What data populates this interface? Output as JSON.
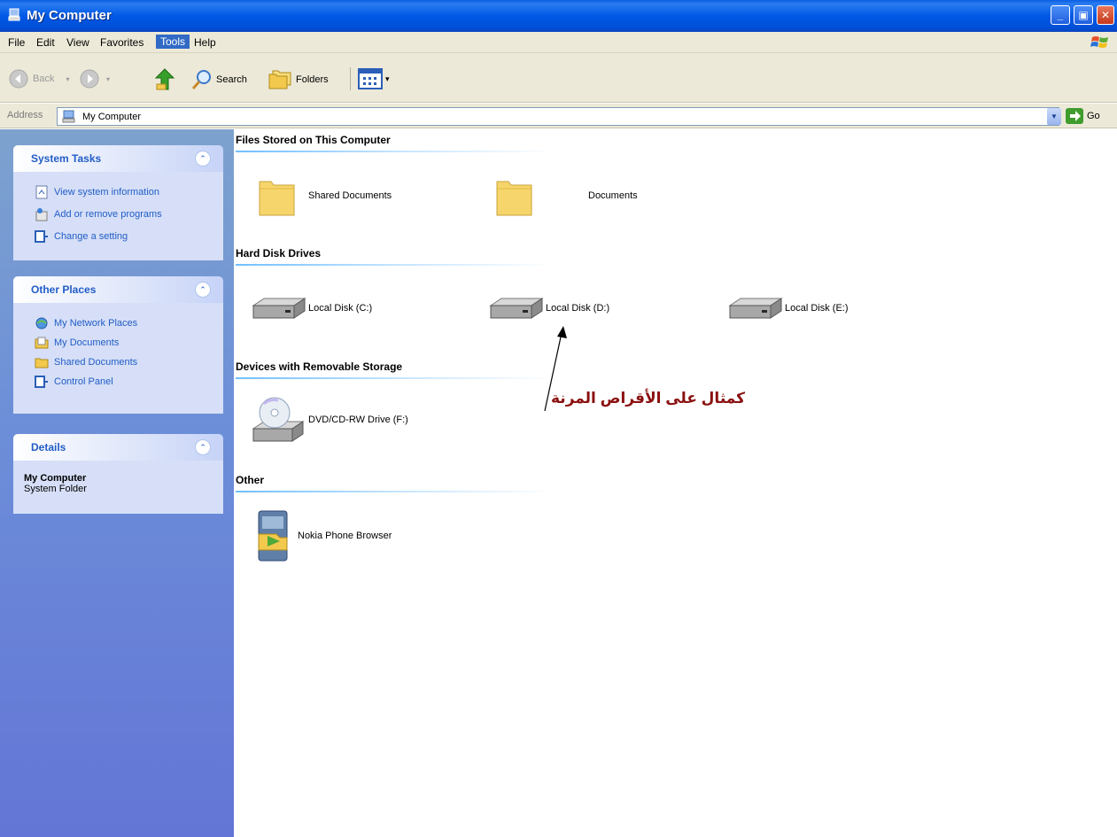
{
  "window": {
    "title": "My Computer"
  },
  "menu": [
    "File",
    "Edit",
    "View",
    "Favorites",
    "Tools",
    "Help"
  ],
  "toolbar": {
    "back": "Back",
    "search": "Search",
    "folders": "Folders"
  },
  "address": {
    "label": "Address",
    "value": "My Computer",
    "go": "Go"
  },
  "sidebar": {
    "system_tasks": {
      "title": "System Tasks",
      "items": [
        "View system information",
        "Add or remove programs",
        "Change a setting"
      ]
    },
    "other_places": {
      "title": "Other Places",
      "items": [
        "My Network Places",
        "My Documents",
        "Shared Documents",
        "Control Panel"
      ]
    },
    "details": {
      "title": "Details",
      "name": "My Computer",
      "type": "System Folder"
    }
  },
  "sections": {
    "files": {
      "title": "Files Stored on This Computer",
      "items": [
        "Shared Documents",
        "Documents"
      ]
    },
    "hdd": {
      "title": "Hard Disk Drives",
      "items": [
        "Local Disk (C:)",
        "Local Disk (D:)",
        "Local Disk (E:)"
      ]
    },
    "removable": {
      "title": "Devices with Removable Storage",
      "items": [
        "DVD/CD-RW Drive (F:)"
      ]
    },
    "other": {
      "title": "Other",
      "items": [
        "Nokia Phone Browser"
      ]
    }
  },
  "annotation": {
    "text": "كمثال على الأقراص المرنة"
  },
  "colors": {
    "link_blue": "#215dc6",
    "pane_bg": "#d6dff7",
    "annotation": "#8b1010"
  }
}
